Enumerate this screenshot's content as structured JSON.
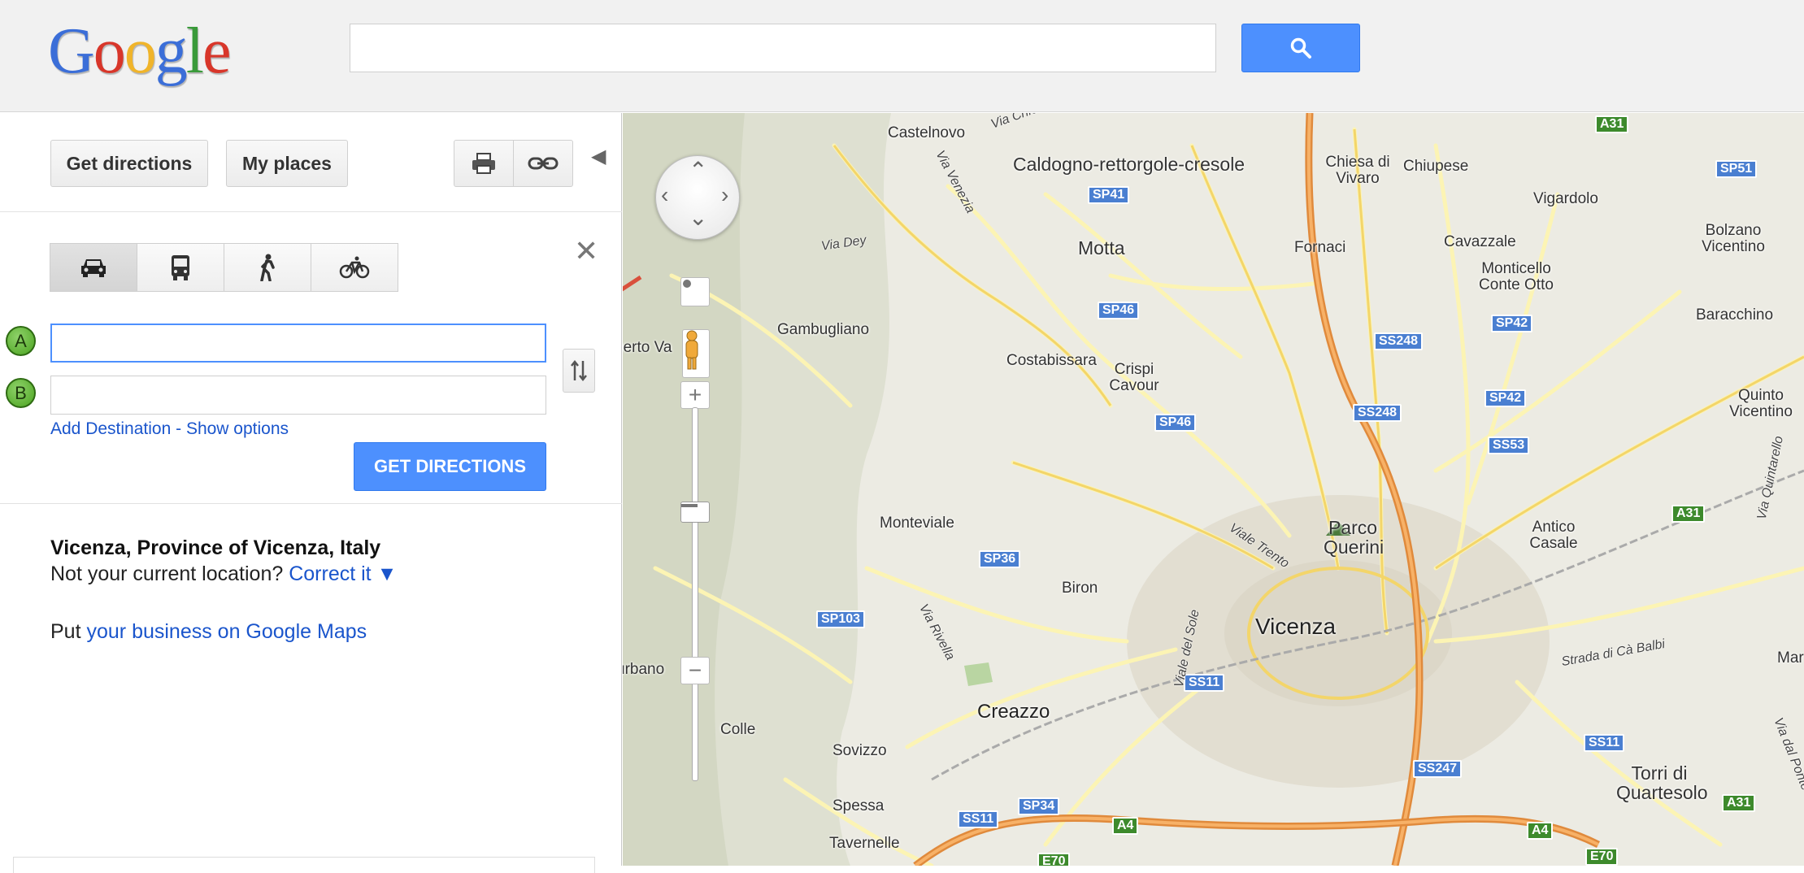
{
  "header": {
    "logo_text": "Google",
    "logo_letters": [
      {
        "ch": "G",
        "color": "#3b6ed8"
      },
      {
        "ch": "o",
        "color": "#d8362a"
      },
      {
        "ch": "o",
        "color": "#f0b42a"
      },
      {
        "ch": "g",
        "color": "#3b6ed8"
      },
      {
        "ch": "l",
        "color": "#3a9a3a"
      },
      {
        "ch": "e",
        "color": "#d8362a"
      }
    ],
    "search_value": "",
    "search_icon": "search-icon"
  },
  "toolbar": {
    "get_directions_label": "Get directions",
    "my_places_label": "My places",
    "print_icon": "print-icon",
    "link_icon": "link-icon",
    "collapse_icon": "collapse-left-icon"
  },
  "directions": {
    "modes": [
      {
        "name": "car",
        "icon": "car-icon",
        "active": true
      },
      {
        "name": "transit",
        "icon": "bus-icon",
        "active": false
      },
      {
        "name": "walking",
        "icon": "walking-icon",
        "active": false
      },
      {
        "name": "bicycling",
        "icon": "bicycle-icon",
        "active": false
      }
    ],
    "close_label": "✕",
    "waypoint_a": {
      "marker": "A",
      "value": ""
    },
    "waypoint_b": {
      "marker": "B",
      "value": ""
    },
    "add_destination_label": "Add Destination",
    "separator": " - ",
    "show_options_label": "Show options",
    "get_directions_button": "GET DIRECTIONS"
  },
  "location": {
    "title": "Vicenza, Province of Vicenza, Italy",
    "not_current_text": "Not your current location?",
    "correct_it_label": "Correct it ▼",
    "put_text": "Put",
    "business_link": "your business on Google Maps"
  },
  "map": {
    "places": [
      {
        "name": "Castelnovo"
      },
      {
        "name": "Caldogno-rettorgole-cresole"
      },
      {
        "name": "Chiesa di Vivaro"
      },
      {
        "name": "Chiupese"
      },
      {
        "name": "Vigardolo"
      },
      {
        "name": "Bolzano Vicentino"
      },
      {
        "name": "Motta"
      },
      {
        "name": "Fornaci"
      },
      {
        "name": "Cavazzale"
      },
      {
        "name": "Monticello Conte Otto"
      },
      {
        "name": "Baracchino"
      },
      {
        "name": "Gambugliano"
      },
      {
        "name": "Costabissara"
      },
      {
        "name": "Crispi Cavour"
      },
      {
        "name": "Quinto Vicentino"
      },
      {
        "name": "Monteviale"
      },
      {
        "name": "Parco Querini"
      },
      {
        "name": "Antico Casale"
      },
      {
        "name": "Biron"
      },
      {
        "name": "Vicenza"
      },
      {
        "name": "Creazzo"
      },
      {
        "name": "Colle"
      },
      {
        "name": "Sovizzo"
      },
      {
        "name": "Torri di Quartesolo"
      },
      {
        "name": "Spessa"
      },
      {
        "name": "Tavernelle"
      },
      {
        "name": "urbano"
      },
      {
        "name": "berto Va"
      },
      {
        "name": "Mar"
      }
    ],
    "roads": [
      "SP41",
      "SP46",
      "SP46",
      "SS248",
      "SS248",
      "SP42",
      "SP42",
      "SS53",
      "SP36",
      "SP103",
      "SS11",
      "SS11",
      "SS11",
      "SS247",
      "SP34",
      "SP51",
      "A31",
      "A31",
      "A31",
      "A4",
      "A4",
      "E70",
      "E70"
    ],
    "streets": [
      "Via Chio",
      "Via Venezia",
      "Via Dey",
      "Viale Trento",
      "Via Rivella",
      "Viale del Sole",
      "Strada di Cà Balbi",
      "Via Quintarello",
      "Via dal Ponte"
    ]
  }
}
